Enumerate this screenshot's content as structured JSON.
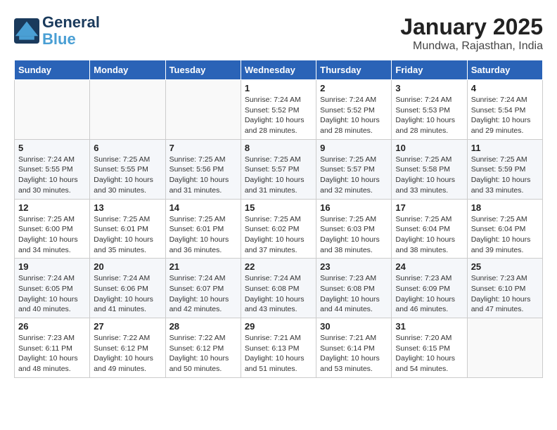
{
  "header": {
    "logo_line1": "General",
    "logo_line2": "Blue",
    "title": "January 2025",
    "subtitle": "Mundwa, Rajasthan, India"
  },
  "weekdays": [
    "Sunday",
    "Monday",
    "Tuesday",
    "Wednesday",
    "Thursday",
    "Friday",
    "Saturday"
  ],
  "weeks": [
    [
      {
        "day": "",
        "info": ""
      },
      {
        "day": "",
        "info": ""
      },
      {
        "day": "",
        "info": ""
      },
      {
        "day": "1",
        "info": "Sunrise: 7:24 AM\nSunset: 5:52 PM\nDaylight: 10 hours\nand 28 minutes."
      },
      {
        "day": "2",
        "info": "Sunrise: 7:24 AM\nSunset: 5:52 PM\nDaylight: 10 hours\nand 28 minutes."
      },
      {
        "day": "3",
        "info": "Sunrise: 7:24 AM\nSunset: 5:53 PM\nDaylight: 10 hours\nand 28 minutes."
      },
      {
        "day": "4",
        "info": "Sunrise: 7:24 AM\nSunset: 5:54 PM\nDaylight: 10 hours\nand 29 minutes."
      }
    ],
    [
      {
        "day": "5",
        "info": "Sunrise: 7:24 AM\nSunset: 5:55 PM\nDaylight: 10 hours\nand 30 minutes."
      },
      {
        "day": "6",
        "info": "Sunrise: 7:25 AM\nSunset: 5:55 PM\nDaylight: 10 hours\nand 30 minutes."
      },
      {
        "day": "7",
        "info": "Sunrise: 7:25 AM\nSunset: 5:56 PM\nDaylight: 10 hours\nand 31 minutes."
      },
      {
        "day": "8",
        "info": "Sunrise: 7:25 AM\nSunset: 5:57 PM\nDaylight: 10 hours\nand 31 minutes."
      },
      {
        "day": "9",
        "info": "Sunrise: 7:25 AM\nSunset: 5:57 PM\nDaylight: 10 hours\nand 32 minutes."
      },
      {
        "day": "10",
        "info": "Sunrise: 7:25 AM\nSunset: 5:58 PM\nDaylight: 10 hours\nand 33 minutes."
      },
      {
        "day": "11",
        "info": "Sunrise: 7:25 AM\nSunset: 5:59 PM\nDaylight: 10 hours\nand 33 minutes."
      }
    ],
    [
      {
        "day": "12",
        "info": "Sunrise: 7:25 AM\nSunset: 6:00 PM\nDaylight: 10 hours\nand 34 minutes."
      },
      {
        "day": "13",
        "info": "Sunrise: 7:25 AM\nSunset: 6:01 PM\nDaylight: 10 hours\nand 35 minutes."
      },
      {
        "day": "14",
        "info": "Sunrise: 7:25 AM\nSunset: 6:01 PM\nDaylight: 10 hours\nand 36 minutes."
      },
      {
        "day": "15",
        "info": "Sunrise: 7:25 AM\nSunset: 6:02 PM\nDaylight: 10 hours\nand 37 minutes."
      },
      {
        "day": "16",
        "info": "Sunrise: 7:25 AM\nSunset: 6:03 PM\nDaylight: 10 hours\nand 38 minutes."
      },
      {
        "day": "17",
        "info": "Sunrise: 7:25 AM\nSunset: 6:04 PM\nDaylight: 10 hours\nand 38 minutes."
      },
      {
        "day": "18",
        "info": "Sunrise: 7:25 AM\nSunset: 6:04 PM\nDaylight: 10 hours\nand 39 minutes."
      }
    ],
    [
      {
        "day": "19",
        "info": "Sunrise: 7:24 AM\nSunset: 6:05 PM\nDaylight: 10 hours\nand 40 minutes."
      },
      {
        "day": "20",
        "info": "Sunrise: 7:24 AM\nSunset: 6:06 PM\nDaylight: 10 hours\nand 41 minutes."
      },
      {
        "day": "21",
        "info": "Sunrise: 7:24 AM\nSunset: 6:07 PM\nDaylight: 10 hours\nand 42 minutes."
      },
      {
        "day": "22",
        "info": "Sunrise: 7:24 AM\nSunset: 6:08 PM\nDaylight: 10 hours\nand 43 minutes."
      },
      {
        "day": "23",
        "info": "Sunrise: 7:23 AM\nSunset: 6:08 PM\nDaylight: 10 hours\nand 44 minutes."
      },
      {
        "day": "24",
        "info": "Sunrise: 7:23 AM\nSunset: 6:09 PM\nDaylight: 10 hours\nand 46 minutes."
      },
      {
        "day": "25",
        "info": "Sunrise: 7:23 AM\nSunset: 6:10 PM\nDaylight: 10 hours\nand 47 minutes."
      }
    ],
    [
      {
        "day": "26",
        "info": "Sunrise: 7:23 AM\nSunset: 6:11 PM\nDaylight: 10 hours\nand 48 minutes."
      },
      {
        "day": "27",
        "info": "Sunrise: 7:22 AM\nSunset: 6:12 PM\nDaylight: 10 hours\nand 49 minutes."
      },
      {
        "day": "28",
        "info": "Sunrise: 7:22 AM\nSunset: 6:12 PM\nDaylight: 10 hours\nand 50 minutes."
      },
      {
        "day": "29",
        "info": "Sunrise: 7:21 AM\nSunset: 6:13 PM\nDaylight: 10 hours\nand 51 minutes."
      },
      {
        "day": "30",
        "info": "Sunrise: 7:21 AM\nSunset: 6:14 PM\nDaylight: 10 hours\nand 53 minutes."
      },
      {
        "day": "31",
        "info": "Sunrise: 7:20 AM\nSunset: 6:15 PM\nDaylight: 10 hours\nand 54 minutes."
      },
      {
        "day": "",
        "info": ""
      }
    ]
  ]
}
